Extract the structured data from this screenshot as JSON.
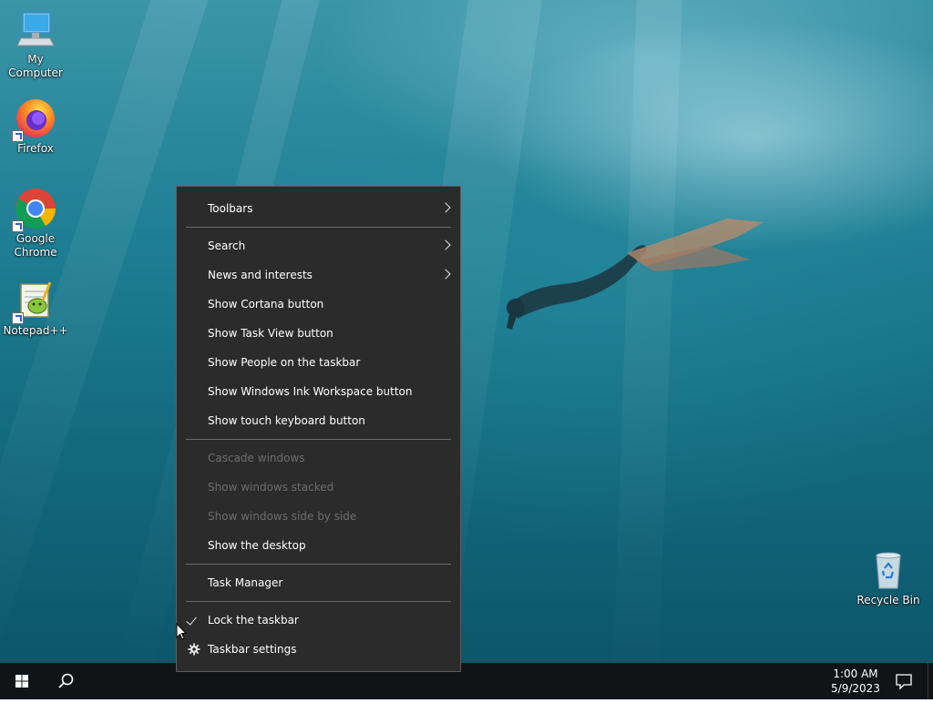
{
  "desktop": {
    "icons": [
      {
        "id": "my-computer",
        "label": "My Computer",
        "icon": "computer-icon"
      },
      {
        "id": "firefox",
        "label": "Firefox",
        "icon": "firefox-icon"
      },
      {
        "id": "chrome",
        "label": "Google Chrome",
        "icon": "chrome-icon"
      },
      {
        "id": "notepad",
        "label": "Notepad++",
        "icon": "notepad-plus-plus-icon"
      },
      {
        "id": "recycle-bin",
        "label": "Recycle Bin",
        "icon": "recycle-bin-icon"
      }
    ]
  },
  "context_menu": {
    "items": [
      {
        "label": "Toolbars",
        "submenu": true
      },
      {
        "label": "Search",
        "submenu": true
      },
      {
        "label": "News and interests",
        "submenu": true
      },
      {
        "label": "Show Cortana button"
      },
      {
        "label": "Show Task View button"
      },
      {
        "label": "Show People on the taskbar"
      },
      {
        "label": "Show Windows Ink Workspace button"
      },
      {
        "label": "Show touch keyboard button"
      },
      {
        "label": "Cascade windows",
        "disabled": true
      },
      {
        "label": "Show windows stacked",
        "disabled": true
      },
      {
        "label": "Show windows side by side",
        "disabled": true
      },
      {
        "label": "Show the desktop"
      },
      {
        "label": "Task Manager"
      },
      {
        "label": "Lock the taskbar",
        "checked": true
      },
      {
        "label": "Taskbar settings",
        "icon": "gear-icon"
      }
    ]
  },
  "taskbar": {
    "start_icon": "windows-logo-icon",
    "search_icon": "search-icon",
    "clock": {
      "time": "1:00 AM",
      "date": "5/9/2023"
    },
    "notification_icon": "action-center-icon"
  },
  "colors": {
    "menu_bg": "#2b2b2b",
    "menu_text": "#ffffff",
    "menu_disabled_text": "#6d6d6d",
    "taskbar_bg": "#101417",
    "accent_blue": "#2a62c9"
  }
}
